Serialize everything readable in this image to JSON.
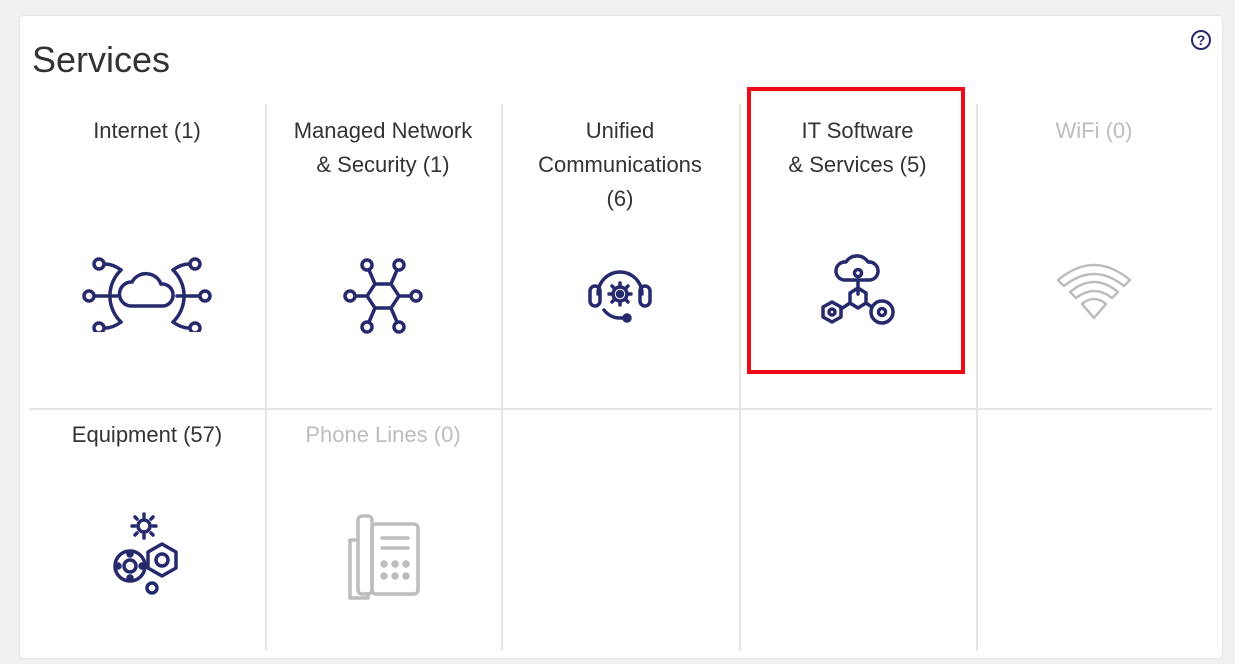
{
  "panel": {
    "title": "Services",
    "help_label": "?"
  },
  "colors": {
    "icon_active": "#262a6d",
    "icon_disabled": "#bdbdbd",
    "highlight": "#ec0b16",
    "text": "#333333"
  },
  "tiles": [
    {
      "label_line1": "Internet (1)",
      "label_line2": "",
      "label_line3": "",
      "icon": "cloud-network-icon",
      "enabled": true
    },
    {
      "label_line1": "Managed Network",
      "label_line2": "& Security (1)",
      "label_line3": "",
      "icon": "network-hub-icon",
      "enabled": true
    },
    {
      "label_line1": "Unified",
      "label_line2": "Communications",
      "label_line3": "(6)",
      "icon": "headset-gear-icon",
      "enabled": true
    },
    {
      "label_line1": "IT Software",
      "label_line2": "& Services (5)",
      "label_line3": "",
      "icon": "cloud-hexagons-icon",
      "enabled": true,
      "highlighted": true
    },
    {
      "label_line1": "WiFi (0)",
      "label_line2": "",
      "label_line3": "",
      "icon": "wifi-icon",
      "enabled": false
    },
    {
      "label_line1": "Equipment (57)",
      "label_line2": "",
      "label_line3": "",
      "icon": "gears-icon",
      "enabled": true
    },
    {
      "label_line1": "Phone Lines (0)",
      "label_line2": "",
      "label_line3": "",
      "icon": "desk-phone-icon",
      "enabled": false
    }
  ]
}
